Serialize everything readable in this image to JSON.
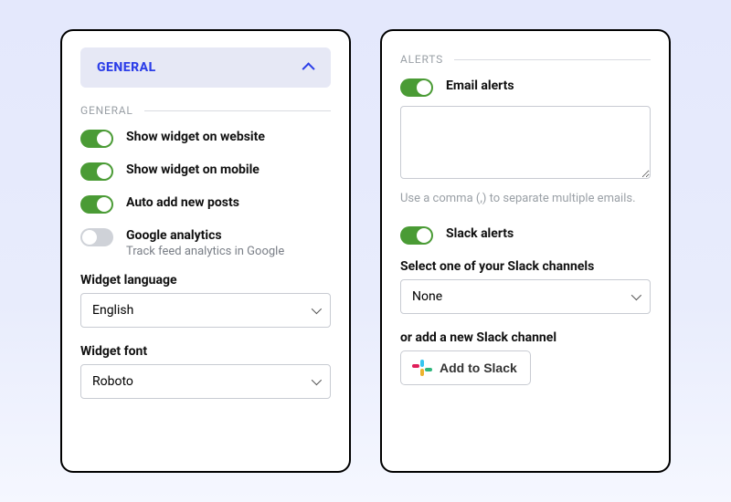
{
  "left": {
    "accordion_title": "GENERAL",
    "section_label": "GENERAL",
    "toggles": [
      {
        "label": "Show widget on website",
        "on": true
      },
      {
        "label": "Show widget on mobile",
        "on": true
      },
      {
        "label": "Auto add new posts",
        "on": true
      },
      {
        "label": "Google analytics",
        "on": false,
        "sub": "Track feed analytics in Google"
      }
    ],
    "language_label": "Widget language",
    "language_value": "English",
    "font_label": "Widget font",
    "font_value": "Roboto"
  },
  "right": {
    "section_label": "ALERTS",
    "email_toggle_label": "Email alerts",
    "email_helper": "Use a comma (,) to separate multiple emails.",
    "slack_toggle_label": "Slack alerts",
    "slack_select_label": "Select one of your Slack channels",
    "slack_select_value": "None",
    "slack_add_label": "or add a new Slack channel",
    "slack_btn_label": "Add to Slack"
  },
  "colors": {
    "accent": "#2c3ee8",
    "toggle_on": "#4a9b35"
  }
}
